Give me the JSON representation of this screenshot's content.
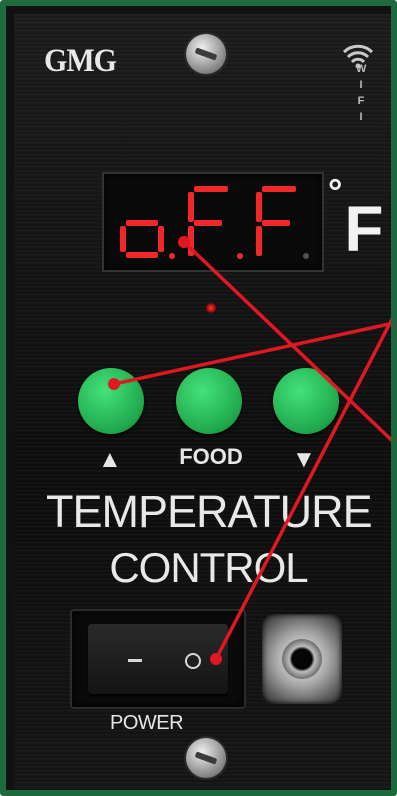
{
  "brand": {
    "logo_text": "GMG"
  },
  "display": {
    "digits": [
      "o",
      "F",
      "F"
    ],
    "unit": "F",
    "degree_symbol": "°"
  },
  "status": {
    "led_color": "#ff3b2f"
  },
  "buttons": [
    {
      "label": "▲",
      "icon": "up-arrow-icon"
    },
    {
      "label": "FOOD",
      "icon": ""
    },
    {
      "label": "▼",
      "icon": "down-arrow-icon"
    }
  ],
  "panel": {
    "title_line1": "TEMPERATURE",
    "title_line2": "CONTROL"
  },
  "power": {
    "label": "POWER",
    "off_mark": "—",
    "on_mark": "O"
  },
  "wifi": {
    "letters": [
      "W",
      "I",
      "F",
      "I"
    ]
  },
  "colors": {
    "button_green": "#1fa84c",
    "annotation_red": "#e01822",
    "border_green": "#1d6b3c"
  }
}
